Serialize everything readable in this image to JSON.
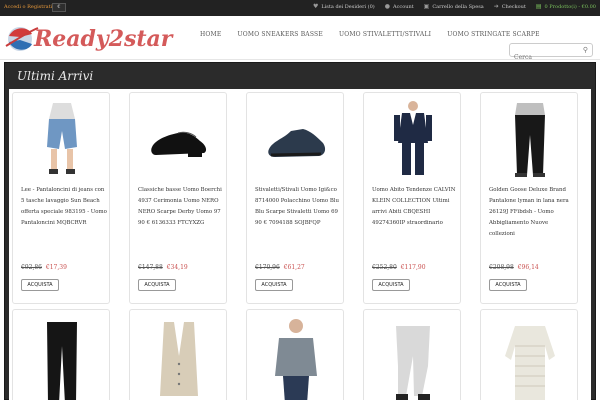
{
  "topbar": {
    "login": "Accedi o Registrati",
    "currency": "€",
    "links": [
      {
        "label": "Lista dei Desideri (0)",
        "icon": "heart-icon"
      },
      {
        "label": "Account",
        "icon": "user-icon"
      },
      {
        "label": "Carrello della Spesa",
        "icon": "cart-icon"
      },
      {
        "label": "Checkout",
        "icon": "checkout-icon"
      }
    ],
    "cart_summary": "0 Prodotto(i) - €0.00"
  },
  "header": {
    "logo_text": "Ready2star",
    "nav": [
      "HOME",
      "UOMO SNEAKERS BASSE",
      "UOMO STIVALETTI/STIVALI",
      "UOMO STRINGATE SCARPE"
    ],
    "search_placeholder": "Cerca"
  },
  "section": {
    "title": "Ultimi Arrivi"
  },
  "products": [
    {
      "desc": "Lee - Pantaloncini di jeans con 5 tasche lavaggio Sun Beach offerta speciale 983195 - Uomo Pantaloncini MQBCRVR",
      "old_price": "€92,86",
      "new_price": "€17,39",
      "button": "ACQUISTA",
      "icon": "shorts-icon"
    },
    {
      "desc": "Classiche basse Uomo Boerchi 4937 Cerimonia Uomo NERO NERO Scarpe Derby Uomo 97 90 € 6136333 FTCYXZG",
      "old_price": "€147,88",
      "new_price": "€34,19",
      "button": "ACQUISTA",
      "icon": "dress-shoe-icon"
    },
    {
      "desc": "Stivaletti/Stivali Uomo Igi&co 8714000 Polacchino Uomo Blu Blu Scarpe Stivaletti Uomo 69 90 € 7094188 SOJBFQP",
      "old_price": "€170,96",
      "new_price": "€61,27",
      "button": "ACQUISTA",
      "icon": "boot-icon"
    },
    {
      "desc": "Uomo Abito Tendenze CALVIN KLEIN COLLECTION Ultimi arrivi Abiti CBQESHI 49274360IP straordinario",
      "old_price": "€252,80",
      "new_price": "€117,90",
      "button": "ACQUISTA",
      "icon": "suit-icon"
    },
    {
      "desc": "Golden Goose Deluxe Brand Pantalone lyman in lana nera 26129J FFibdsh - Uomo Abbigliamento Nuove collezioni",
      "old_price": "€208,98",
      "new_price": "€96,14",
      "button": "ACQUISTA",
      "icon": "trousers-icon"
    }
  ],
  "products_row2": [
    {
      "icon": "jeans-icon"
    },
    {
      "icon": "vest-icon"
    },
    {
      "icon": "polo-icon"
    },
    {
      "icon": "joggers-icon"
    },
    {
      "icon": "sweater-icon"
    }
  ],
  "colors": {
    "topbar_bg": "#222222",
    "login_accent": "#e89a3c",
    "cart_accent": "#7bc25d",
    "sale_price": "#c9504f",
    "section_bg": "#2b2b2b"
  }
}
